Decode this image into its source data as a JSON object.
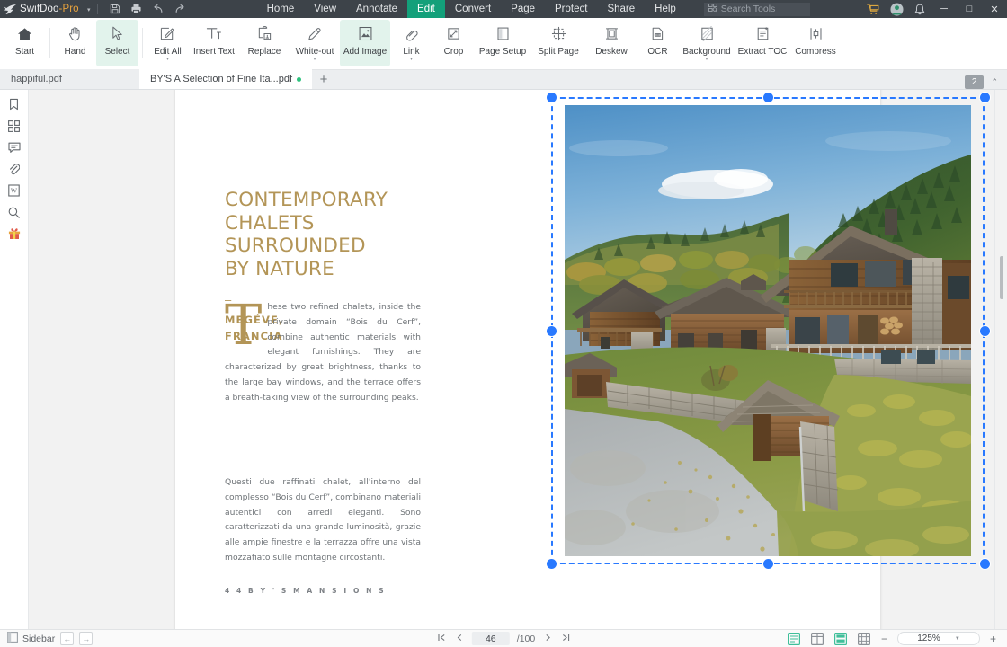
{
  "titlebar": {
    "brand": "SwifDoo",
    "brand_suffix": "-Pro",
    "brand_caret": "▾",
    "quick_actions": [
      {
        "name": "save-icon",
        "label": "Save"
      },
      {
        "name": "print-icon",
        "label": "Print"
      },
      {
        "name": "undo-icon",
        "label": "Undo"
      },
      {
        "name": "redo-icon",
        "label": "Redo"
      }
    ],
    "menus": [
      {
        "label": "Home",
        "active": false
      },
      {
        "label": "View",
        "active": false
      },
      {
        "label": "Annotate",
        "active": false
      },
      {
        "label": "Edit",
        "active": true
      },
      {
        "label": "Convert",
        "active": false
      },
      {
        "label": "Page",
        "active": false
      },
      {
        "label": "Protect",
        "active": false
      },
      {
        "label": "Share",
        "active": false
      },
      {
        "label": "Help",
        "active": false
      }
    ],
    "search_placeholder": "Search Tools",
    "right_icons": [
      {
        "name": "cart-icon"
      },
      {
        "name": "account-avatar-icon"
      },
      {
        "name": "notification-bell-icon"
      }
    ],
    "window_controls": {
      "minimize": "─",
      "maximize": "□",
      "close": "✕"
    },
    "accent_color": "#13a07a",
    "bg_color": "#3d4349"
  },
  "ribbon": {
    "items": [
      {
        "label": "Start",
        "icon": "home-icon",
        "active": false,
        "caret": false
      },
      {
        "label": "Hand",
        "icon": "hand-icon",
        "active": false,
        "caret": false
      },
      {
        "label": "Select",
        "icon": "cursor-icon",
        "active": true,
        "caret": false
      },
      {
        "label": "Edit All",
        "icon": "edit-all-icon",
        "active": false,
        "caret": true
      },
      {
        "label": "Insert Text",
        "icon": "insert-text-icon",
        "active": false,
        "caret": false
      },
      {
        "label": "Replace",
        "icon": "replace-icon",
        "active": false,
        "caret": false
      },
      {
        "label": "White-out",
        "icon": "whiteout-icon",
        "active": false,
        "caret": true
      },
      {
        "label": "Add Image",
        "icon": "add-image-icon",
        "active": true,
        "caret": false
      },
      {
        "label": "Link",
        "icon": "link-icon",
        "active": false,
        "caret": true
      },
      {
        "label": "Crop",
        "icon": "crop-icon",
        "active": false,
        "caret": false
      },
      {
        "label": "Page Setup",
        "icon": "page-setup-icon",
        "active": false,
        "caret": false
      },
      {
        "label": "Split Page",
        "icon": "split-page-icon",
        "active": false,
        "caret": false
      },
      {
        "label": "Deskew",
        "icon": "deskew-icon",
        "active": false,
        "caret": false
      },
      {
        "label": "OCR",
        "icon": "ocr-icon",
        "active": false,
        "caret": false
      },
      {
        "label": "Background",
        "icon": "background-icon",
        "active": false,
        "caret": true
      },
      {
        "label": "Extract TOC",
        "icon": "extract-toc-icon",
        "active": false,
        "caret": false
      },
      {
        "label": "Compress",
        "icon": "compress-icon",
        "active": false,
        "caret": false
      }
    ]
  },
  "tabstrip": {
    "tabs": [
      {
        "title": "happiful.pdf",
        "active": false,
        "modified": false
      },
      {
        "title": "BY'S A Selection of Fine Ita...pdf",
        "active": true,
        "modified": true
      }
    ],
    "new_tab_label": "+",
    "open_count": "2",
    "collapse_caret": "⌃"
  },
  "sidebar_rail": {
    "items": [
      {
        "name": "bookmark-icon",
        "label": "Bookmarks"
      },
      {
        "name": "thumbnails-icon",
        "label": "Thumbnails"
      },
      {
        "name": "comments-icon",
        "label": "Comments"
      },
      {
        "name": "attachment-icon",
        "label": "Attachments"
      },
      {
        "name": "word-icon",
        "label": "Convert to Word"
      },
      {
        "name": "search-icon",
        "label": "Search"
      },
      {
        "name": "gift-icon",
        "label": "Gift"
      }
    ]
  },
  "document": {
    "title_lines": [
      "CONTEMPORARY",
      "CHALETS",
      "SURROUNDED",
      "BY NATURE"
    ],
    "rule": "–",
    "location_lines": [
      "MEGÉVE,",
      "FRANCIA"
    ],
    "dropcap": "T",
    "body_en": "hese two refined chalets, inside the private domain “Bois du Cerf”, combine authentic materials with elegant furnishings. They are characterized by great brightness, thanks to the large bay windows, and the terrace offers a breath-taking view of the surrounding peaks.",
    "body_it": "Questi due raffinati chalet, all’interno del complesso “Bois du Cerf”, combinano materiali autentici con arredi eleganti. Sono caratterizzati da una grande luminosità, grazie alle ampie finestre e la terrazza offre una vista mozzafiato sulle montagne circostanti.",
    "folio": "4 4   B Y ' S    M A N S I O N S",
    "title_color": "#b39557",
    "image": {
      "alt": "Wooden alpine chalets on a hillside with autumn forest and blue sky",
      "selected": true,
      "selection_color": "#2979ff",
      "handles": 8
    }
  },
  "statusbar": {
    "sidebar_label": "Sidebar",
    "prev_page_arrow": "←",
    "next_page_arrow": "→",
    "first_page": "⏮",
    "prev_page": "‹",
    "next_page": "›",
    "last_page": "⏭",
    "current_page": "46",
    "total_pages": "/100",
    "view_modes": [
      {
        "name": "single-page-view-icon",
        "active": true
      },
      {
        "name": "two-page-view-icon",
        "active": false
      },
      {
        "name": "continuous-scroll-icon",
        "active": true
      },
      {
        "name": "grid-view-icon",
        "active": false
      }
    ],
    "zoom_out": "−",
    "zoom_in": "+",
    "zoom_level": "125%",
    "zoom_caret": "▼"
  }
}
